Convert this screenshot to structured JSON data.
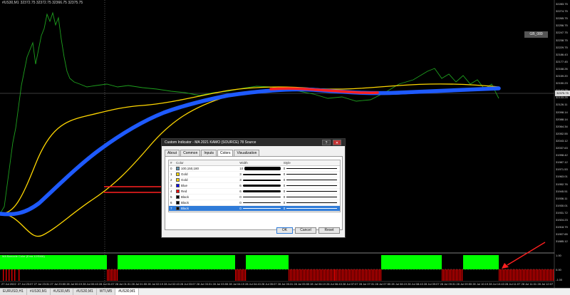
{
  "header": {
    "symbol_title": "#US30,M1",
    "ohlc": "32372.75 32372.75 32366.75 32375.75"
  },
  "price_tag": "GB_089",
  "current_price": "32375.75",
  "y_axis": [
    "32283.75",
    "32274.75",
    "32265.75",
    "32256.75",
    "32247.75",
    "32238.75",
    "32229.75",
    "32186.43",
    "32177.45",
    "32168.26",
    "32159.20",
    "32150.23",
    "32142.25",
    "32133.25",
    "32126.11",
    "32098.14",
    "32088.14",
    "32064.34",
    "32052.55",
    "32043.12",
    "32037.63",
    "31998.42",
    "31987.12",
    "31971.53",
    "31963.01",
    "31952.76",
    "31945.51",
    "31936.11",
    "31930.01",
    "31931.72",
    "31924.23",
    "31918.79",
    "31907.65",
    "31885.12"
  ],
  "x_axis": [
    "27 Jul 2022",
    "27 Jul 23:07",
    "27 Jul 23:31",
    "27 Jul 23:55",
    "28 Jul 00:19",
    "28 Jul 00:43",
    "28 Jul 01:07",
    "28 Jul 01:31",
    "28 Jul 01:55",
    "28 Jul 02:19",
    "28 Jul 02:43",
    "28 Jul 03:07",
    "28 Jul 03:31",
    "28 Jul 03:55",
    "28 Jul 04:19",
    "28 Jul 04:43",
    "28 Jul 05:07",
    "28 Jul 05:31",
    "28 Jul 05:55",
    "28 Jul 06:19",
    "28 Jul 06:43",
    "28 Jul 07:07",
    "28 Jul 07:31",
    "28 Jul 07:55",
    "28 Jul 08:19",
    "28 Jul 08:43",
    "28 Jul 09:07",
    "28 Jul 09:31",
    "28 Jul 09:55",
    "28 Jul 10:19",
    "28 Jul 10:43",
    "28 Jul 11:07",
    "28 Jul 11:31",
    "28 Jul 12:07"
  ],
  "subwindow": {
    "label": "MA Barcode Color (Ema 12/SMA)",
    "y_ticks": [
      "1.00",
      "0.00",
      "-1.00"
    ]
  },
  "tabs": [
    "EURUSD,H1",
    "#US30,M1",
    "#US30,M5",
    "#US30,M1",
    "WTI,M5",
    "#US30,M1"
  ],
  "active_tab": 5,
  "dialog": {
    "title": "Custom Indicator - MA 2021 KAMO (SOURCE) 78 Source",
    "help": "?",
    "close": "✕",
    "tabs": [
      "About",
      "Common",
      "Inputs",
      "Colors",
      "Visualization"
    ],
    "active_tab": 3,
    "columns": {
      "index": "#",
      "color": "Color",
      "width": "Width",
      "style": "Style"
    },
    "rows": [
      {
        "idx": "0",
        "color_name": "100,150,180",
        "swatch": "#6496b4",
        "width": "10",
        "style": "0"
      },
      {
        "idx": "1",
        "color_name": "Gold",
        "swatch": "#ffd700",
        "width": "3",
        "style": "0"
      },
      {
        "idx": "2",
        "color_name": "Gold",
        "swatch": "#ffd700",
        "width": "3",
        "style": "0"
      },
      {
        "idx": "3",
        "color_name": "Blue",
        "swatch": "#0000ff",
        "width": "6",
        "style": "0"
      },
      {
        "idx": "4",
        "color_name": "Red",
        "swatch": "#ff0000",
        "width": "6",
        "style": "0"
      },
      {
        "idx": "5",
        "color_name": "Black",
        "swatch": "#000000",
        "width": "0",
        "style": "0"
      },
      {
        "idx": "6",
        "color_name": "Black",
        "swatch": "#000000",
        "width": "0",
        "style": "0"
      },
      {
        "idx": "7",
        "color_name": "Black",
        "swatch": "#000000",
        "width": "0",
        "style": "0"
      }
    ],
    "selected_row": 7,
    "buttons": {
      "ok": "OK",
      "cancel": "Cancel",
      "reset": "Reset"
    }
  },
  "colors": {
    "price_line": "#1ea01e",
    "gold": "#ffd700",
    "blue": "#1e5aff",
    "red": "#ff2020",
    "bar_green": "#00ff00",
    "bar_red": "#e00000"
  }
}
